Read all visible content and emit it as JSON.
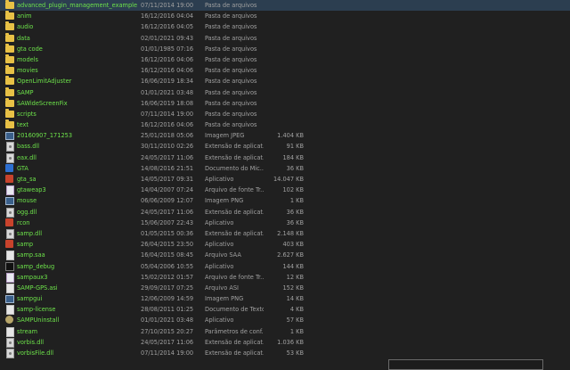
{
  "files": [
    {
      "name": "advanced_plugin_management_example",
      "date": "07/11/2014 19:00",
      "type": "Pasta de arquivos",
      "size": "",
      "icon": "folder-icon"
    },
    {
      "name": "anim",
      "date": "16/12/2016 04:04",
      "type": "Pasta de arquivos",
      "size": "",
      "icon": "folder-icon"
    },
    {
      "name": "audio",
      "date": "16/12/2016 04:05",
      "type": "Pasta de arquivos",
      "size": "",
      "icon": "folder-icon"
    },
    {
      "name": "data",
      "date": "02/01/2021 09:43",
      "type": "Pasta de arquivos",
      "size": "",
      "icon": "folder-icon"
    },
    {
      "name": "gta code",
      "date": "01/01/1985 07:16",
      "type": "Pasta de arquivos",
      "size": "",
      "icon": "folder-icon"
    },
    {
      "name": "models",
      "date": "16/12/2016 04:06",
      "type": "Pasta de arquivos",
      "size": "",
      "icon": "folder-icon"
    },
    {
      "name": "movies",
      "date": "16/12/2016 04:06",
      "type": "Pasta de arquivos",
      "size": "",
      "icon": "folder-icon"
    },
    {
      "name": "OpenLimitAdjuster",
      "date": "16/06/2019 18:34",
      "type": "Pasta de arquivos",
      "size": "",
      "icon": "folder-icon"
    },
    {
      "name": "SAMP",
      "date": "01/01/2021 03:48",
      "type": "Pasta de arquivos",
      "size": "",
      "icon": "folder-icon"
    },
    {
      "name": "SAWideScreenFix",
      "date": "16/06/2019 18:08",
      "type": "Pasta de arquivos",
      "size": "",
      "icon": "folder-icon"
    },
    {
      "name": "scripts",
      "date": "07/11/2014 19:00",
      "type": "Pasta de arquivos",
      "size": "",
      "icon": "folder-icon"
    },
    {
      "name": "text",
      "date": "16/12/2016 04:06",
      "type": "Pasta de arquivos",
      "size": "",
      "icon": "folder-icon"
    },
    {
      "name": "20160907_171253",
      "date": "25/01/2018 05:06",
      "type": "Imagem JPEG",
      "size": "1.404 KB",
      "icon": "image-icon"
    },
    {
      "name": "bass.dll",
      "date": "30/11/2010 02:26",
      "type": "Extensão de aplicat...",
      "size": "91 KB",
      "icon": "gear-file-icon"
    },
    {
      "name": "eax.dll",
      "date": "24/05/2017 11:06",
      "type": "Extensão de aplicat...",
      "size": "184 KB",
      "icon": "gear-file-icon"
    },
    {
      "name": "GTA",
      "date": "14/08/2016 21:51",
      "type": "Documento do Mic...",
      "size": "36 KB",
      "icon": "word-doc-icon"
    },
    {
      "name": "gta_sa",
      "date": "14/05/2017 09:31",
      "type": "Aplicativo",
      "size": "14.047 KB",
      "icon": "app-icon"
    },
    {
      "name": "gtaweap3",
      "date": "14/04/2007 07:24",
      "type": "Arquivo de fonte Tr...",
      "size": "102 KB",
      "icon": "font-file-icon"
    },
    {
      "name": "mouse",
      "date": "06/06/2009 12:07",
      "type": "Imagem PNG",
      "size": "1 KB",
      "icon": "image-icon"
    },
    {
      "name": "ogg.dll",
      "date": "24/05/2017 11:06",
      "type": "Extensão de aplicat...",
      "size": "36 KB",
      "icon": "gear-file-icon"
    },
    {
      "name": "rcon",
      "date": "15/06/2007 22:43",
      "type": "Aplicativo",
      "size": "36 KB",
      "icon": "app-icon"
    },
    {
      "name": "samp.dll",
      "date": "01/05/2015 00:36",
      "type": "Extensão de aplicat...",
      "size": "2.148 KB",
      "icon": "gear-file-icon"
    },
    {
      "name": "samp",
      "date": "26/04/2015 23:50",
      "type": "Aplicativo",
      "size": "403 KB",
      "icon": "samp-app-icon"
    },
    {
      "name": "samp.saa",
      "date": "16/04/2015 08:45",
      "type": "Arquivo SAA",
      "size": "2.627 KB",
      "icon": "document-icon"
    },
    {
      "name": "samp_debug",
      "date": "05/04/2006 10:55",
      "type": "Aplicativo",
      "size": "144 KB",
      "icon": "console-app-icon"
    },
    {
      "name": "sampaux3",
      "date": "15/02/2012 01:57",
      "type": "Arquivo de fonte Tr...",
      "size": "12 KB",
      "icon": "font-file-icon"
    },
    {
      "name": "SAMP-GPS.asi",
      "date": "29/09/2017 07:25",
      "type": "Arquivo ASI",
      "size": "152 KB",
      "icon": "document-icon"
    },
    {
      "name": "sampgui",
      "date": "12/06/2009 14:59",
      "type": "Imagem PNG",
      "size": "14 KB",
      "icon": "image-icon"
    },
    {
      "name": "samp-license",
      "date": "28/08/2011 01:25",
      "type": "Documento de Texto",
      "size": "4 KB",
      "icon": "text-file-icon"
    },
    {
      "name": "SAMPUninstall",
      "date": "01/01/2021 03:48",
      "type": "Aplicativo",
      "size": "57 KB",
      "icon": "uninstall-app-icon"
    },
    {
      "name": "stream",
      "date": "27/10/2015 20:27",
      "type": "Parâmetros de conf...",
      "size": "1 KB",
      "icon": "config-file-icon"
    },
    {
      "name": "vorbis.dll",
      "date": "24/05/2017 11:06",
      "type": "Extensão de aplicat...",
      "size": "1.036 KB",
      "icon": "gear-file-icon"
    },
    {
      "name": "vorbisFile.dll",
      "date": "07/11/2014 19:00",
      "type": "Extensão de aplicat...",
      "size": "53 KB",
      "icon": "gear-file-icon"
    }
  ]
}
